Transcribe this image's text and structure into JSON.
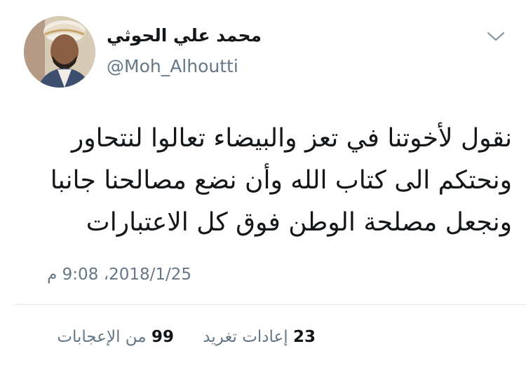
{
  "author": {
    "display_name": "محمد علي الحوثي",
    "handle": "@Moh_Alhoutti"
  },
  "tweet": {
    "lines": [
      "نقول لأخوتنا في تعز والبيضاء تعالوا لنتحاور",
      "ونحتكم الى كتاب الله وأن نضع مصالحنا جانبا",
      "ونجعل مصلحة الوطن فوق كل الاعتبارات"
    ],
    "timestamp": "2018/1/25، 9:08 م"
  },
  "stats": {
    "retweets_count": "23",
    "retweets_label": "إعادات تغريد",
    "likes_count": "99",
    "likes_label": "من الإعجابات"
  },
  "icons": {
    "menu": "chevron-down-icon"
  },
  "colors": {
    "text_primary": "#14171a",
    "text_secondary": "#657786",
    "divider": "#e1e8ed"
  }
}
